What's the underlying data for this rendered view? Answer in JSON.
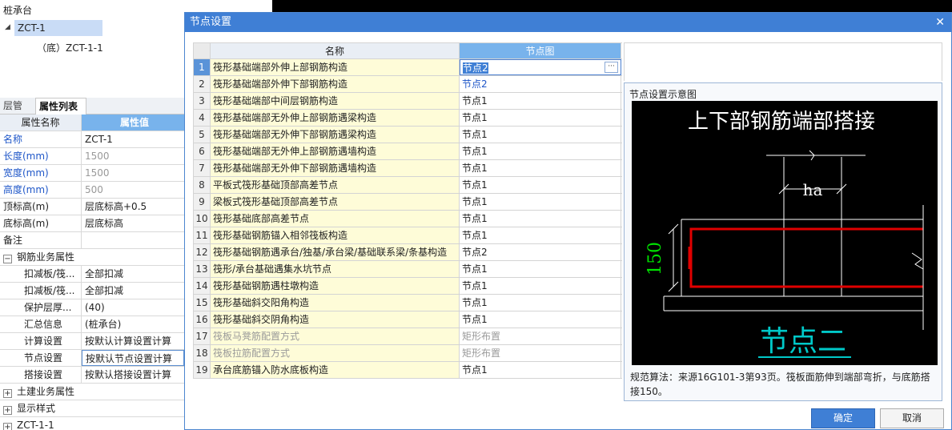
{
  "tree": {
    "title": "桩承台",
    "selected_node": "ZCT-1",
    "child_node": "（底）ZCT-1-1"
  },
  "left_tabs": [
    "层管理",
    "属性列表"
  ],
  "property_table": {
    "headers": [
      "属性名称",
      "属性值"
    ],
    "rows": [
      {
        "name": "名称",
        "value": "ZCT-1"
      },
      {
        "name": "长度(mm)",
        "value": "1500"
      },
      {
        "name": "宽度(mm)",
        "value": "1500"
      },
      {
        "name": "高度(mm)",
        "value": "500"
      },
      {
        "name": "顶标高(m)",
        "value": "层底标高+0.5"
      },
      {
        "name": "底标高(m)",
        "value": "层底标高"
      },
      {
        "name": "备注",
        "value": ""
      },
      {
        "name": "钢筋业务属性",
        "value": ""
      },
      {
        "name": "扣减板/筏...",
        "value": "全部扣减"
      },
      {
        "name": "扣减板/筏...",
        "value": "全部扣减"
      },
      {
        "name": "保护层厚...",
        "value": "(40)"
      },
      {
        "name": "汇总信息",
        "value": "(桩承台)"
      },
      {
        "name": "计算设置",
        "value": "按默认计算设置计算"
      },
      {
        "name": "节点设置",
        "value": "按默认节点设置计算"
      },
      {
        "name": "搭接设置",
        "value": "按默认搭接设置计算"
      },
      {
        "name": "土建业务属性",
        "value": ""
      },
      {
        "name": "显示样式",
        "value": ""
      },
      {
        "name": "ZCT-1-1",
        "value": ""
      }
    ]
  },
  "dialog": {
    "title": "节点设置",
    "grid_headers": [
      "名称",
      "节点图"
    ],
    "rows": [
      {
        "n": "1",
        "name": "筏形基础端部外伸上部钢筋构造",
        "value": "节点2"
      },
      {
        "n": "2",
        "name": "筏形基础端部外伸下部钢筋构造",
        "value": "节点2"
      },
      {
        "n": "3",
        "name": "筏形基础端部中间层钢筋构造",
        "value": "节点1"
      },
      {
        "n": "4",
        "name": "筏形基础端部无外伸上部钢筋遇梁构造",
        "value": "节点1"
      },
      {
        "n": "5",
        "name": "筏形基础端部无外伸下部钢筋遇梁构造",
        "value": "节点1"
      },
      {
        "n": "6",
        "name": "筏形基础端部无外伸上部钢筋遇墙构造",
        "value": "节点1"
      },
      {
        "n": "7",
        "name": "筏形基础端部无外伸下部钢筋遇墙构造",
        "value": "节点1"
      },
      {
        "n": "8",
        "name": "平板式筏形基础顶部高差节点",
        "value": "节点1"
      },
      {
        "n": "9",
        "name": "梁板式筏形基础顶部高差节点",
        "value": "节点1"
      },
      {
        "n": "10",
        "name": "筏形基础底部高差节点",
        "value": "节点1"
      },
      {
        "n": "11",
        "name": "筏形基础钢筋锚入相邻筏板构造",
        "value": "节点1"
      },
      {
        "n": "12",
        "name": "筏形基础钢筋遇承台/独基/承台梁/基础联系梁/条基构造",
        "value": "节点2"
      },
      {
        "n": "13",
        "name": "筏形/承台基础遇集水坑节点",
        "value": "节点1"
      },
      {
        "n": "14",
        "name": "筏形基础钢筋遇柱墩构造",
        "value": "节点1"
      },
      {
        "n": "15",
        "name": "筏形基础斜交阳角构造",
        "value": "节点1"
      },
      {
        "n": "16",
        "name": "筏形基础斜交阴角构造",
        "value": "节点1"
      },
      {
        "n": "17",
        "name": "筏板马凳筋配置方式",
        "value": "矩形布置"
      },
      {
        "n": "18",
        "name": "筏板拉筋配置方式",
        "value": "矩形布置"
      },
      {
        "n": "19",
        "name": "承台底筋锚入防水底板构造",
        "value": "节点1"
      }
    ],
    "preview_label": "节点设置示意图",
    "diagram": {
      "title": "上下部钢筋端部搭接",
      "dim_ha": "ha",
      "dim_150": "150",
      "caption": "节点二"
    },
    "preview_desc": "规范算法：来源16G101-3第93页。筏板面筋伸到端部弯折，与底筋搭接150。",
    "ok_label": "确定",
    "cancel_label": "取消"
  },
  "colors": {
    "accent": "#3f7fd5",
    "header_blue": "#78b3ec",
    "name_cell_bg": "#fefcd8",
    "rebar_red": "#e00000",
    "dim_green": "#00e000",
    "caption_cyan": "#00c8c8"
  }
}
